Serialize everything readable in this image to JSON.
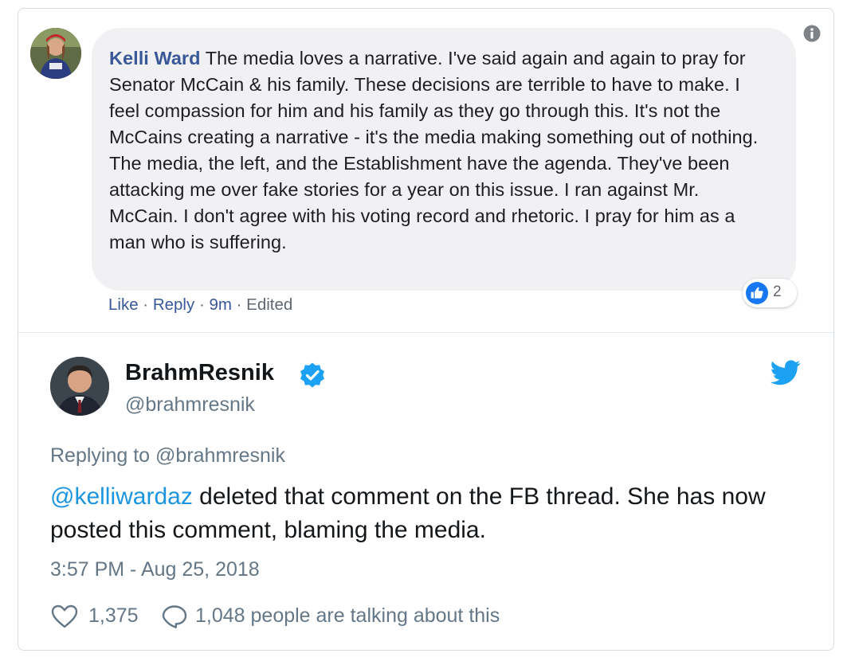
{
  "facebook_comment": {
    "author": "Kelli Ward",
    "text": " The media loves a narrative. I've said again and again to pray for Senator McCain & his family. These decisions are terrible to have to make. I feel compassion for him and his family as they go through this. It's not the McCains creating a narrative - it's the media making something out of nothing. The media, the left, and the Establishment have the agenda. They've been attacking me over fake stories for a year on this issue. I ran against Mr. McCain. I don't agree with his voting record and rhetoric. I pray for him as a man who is suffering.",
    "actions": {
      "like": "Like",
      "sep1": " · ",
      "reply": "Reply",
      "sep2": " · ",
      "time": "9m",
      "sep3": " · ",
      "edited": "Edited"
    },
    "reaction_count": "2",
    "icons": {
      "info": "info-icon",
      "reaction": "like-reaction-icon"
    },
    "colors": {
      "name": "#385898",
      "bubble": "#f1f1f3",
      "like_blue": "#1877f2"
    }
  },
  "tweet": {
    "display_name": "BrahmResnik",
    "handle": "@brahmresnik",
    "replying_prefix": "Replying to ",
    "replying_handle": "@brahmresnik",
    "mention": "@kelliwardaz",
    "body": " deleted that comment on the FB thread. She has now posted this comment, blaming the media.",
    "timestamp": "3:57 PM - Aug 25, 2018",
    "likes": "1,375",
    "talking": "1,048 people are talking about this",
    "icons": {
      "verified": "verified-badge-icon",
      "brand": "twitter-bird-icon",
      "heart": "heart-icon",
      "comment": "comment-bubble-icon"
    },
    "colors": {
      "link": "#1b95e0",
      "muted": "#657786",
      "text": "#14171a"
    }
  }
}
